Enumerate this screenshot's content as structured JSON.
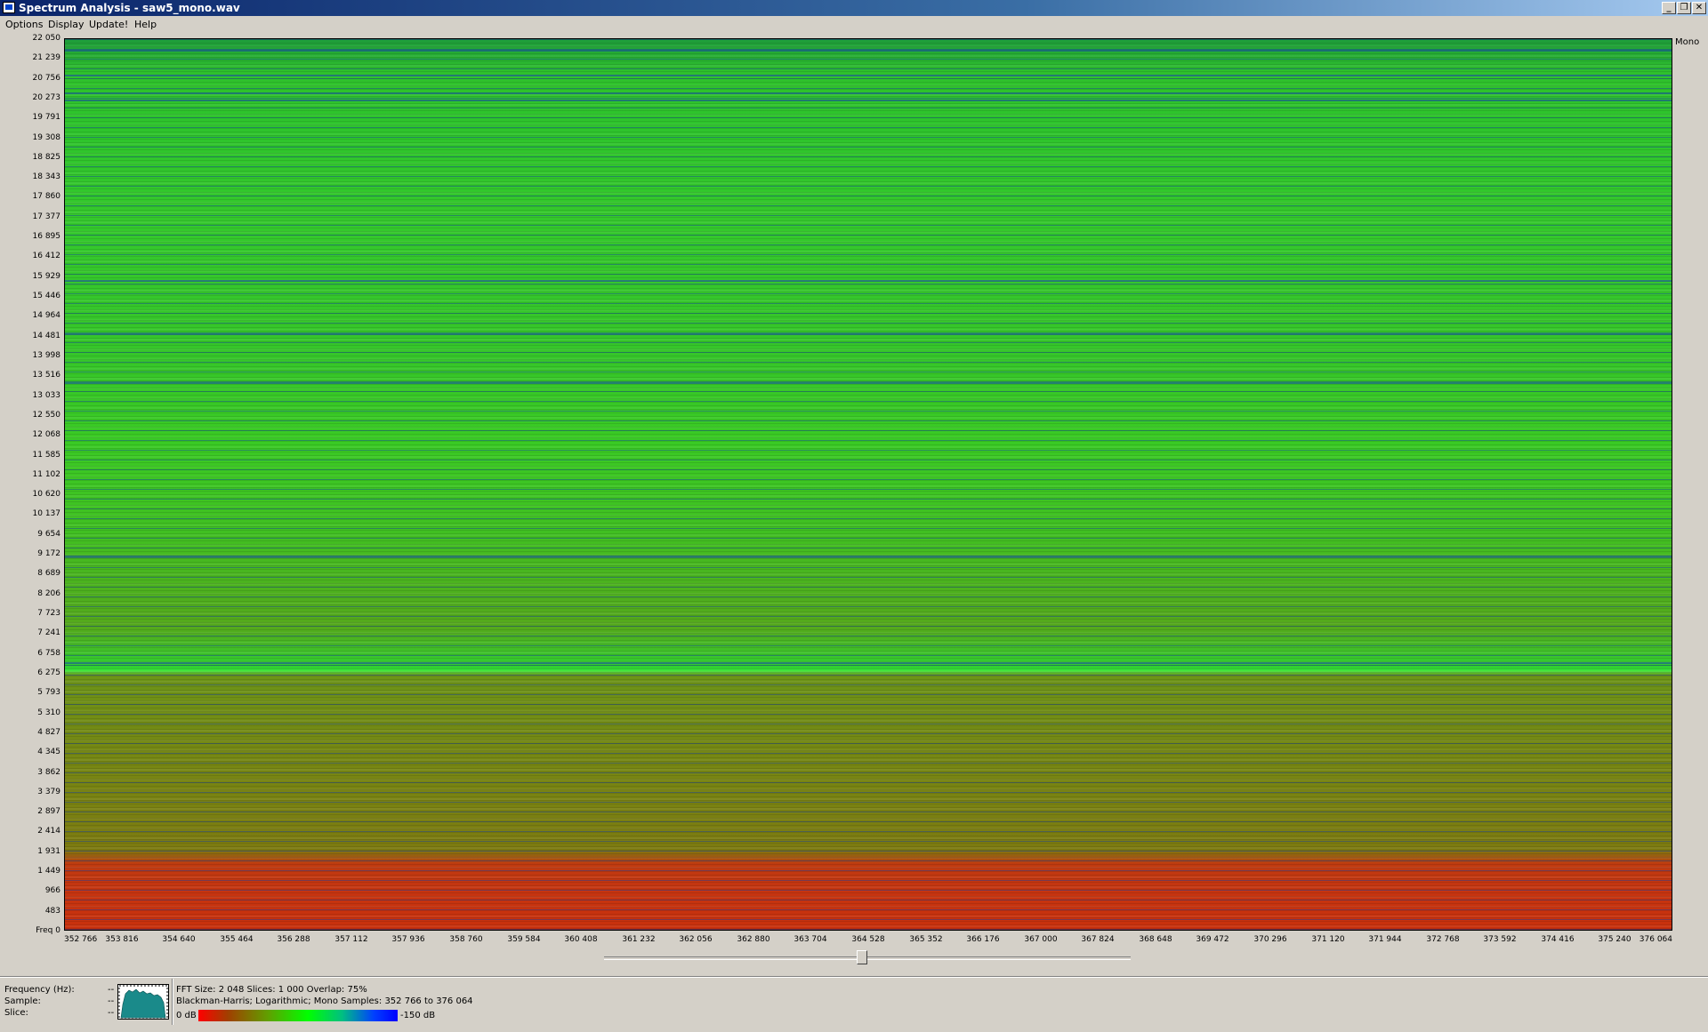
{
  "window": {
    "title": "Spectrum Analysis - saw5_mono.wav",
    "minimize_glyph": "_",
    "restore_glyph": "❐",
    "close_glyph": "✕"
  },
  "menu": {
    "items": [
      "Options",
      "Display",
      "Update!",
      "Help"
    ]
  },
  "plot": {
    "channel_label": "Mono",
    "y_ticks": [
      "22 050",
      "21 239",
      "20 756",
      "20 273",
      "19 791",
      "19 308",
      "18 825",
      "18 343",
      "17 860",
      "17 377",
      "16 895",
      "16 412",
      "15 929",
      "15 446",
      "14 964",
      "14 481",
      "13 998",
      "13 516",
      "13 033",
      "12 550",
      "12 068",
      "11 585",
      "11 102",
      "10 620",
      "10 137",
      "9 654",
      "9 172",
      "8 689",
      "8 206",
      "7 723",
      "7 241",
      "6 758",
      "6 275",
      "5 793",
      "5 310",
      "4 827",
      "4 345",
      "3 862",
      "3 379",
      "2 897",
      "2 414",
      "1 931",
      "1 449",
      "966",
      "483",
      "Freq 0"
    ],
    "x_ticks": [
      "352 766",
      "353 816",
      "354 640",
      "355 464",
      "356 288",
      "357 112",
      "357 936",
      "358 760",
      "359 584",
      "360 408",
      "361 232",
      "362 056",
      "362 880",
      "363 704",
      "364 528",
      "365 352",
      "366 176",
      "367 000",
      "367 824",
      "368 648",
      "369 472",
      "370 296",
      "371 120",
      "371 944",
      "372 768",
      "373 592",
      "374 416",
      "375 240",
      "376 064"
    ],
    "colors": {
      "high": "#c8300c",
      "mid": "#36c62a",
      "low_level": "#1e5ab4"
    }
  },
  "status": {
    "labels": {
      "frequency": "Frequency (Hz):",
      "sample": "Sample:",
      "slice": "Slice:"
    },
    "values": {
      "frequency": "--",
      "sample": "--",
      "slice": "--"
    },
    "info_line1": "FFT Size: 2 048  Slices: 1 000  Overlap: 75%",
    "info_line2": "Blackman-Harris; Logarithmic; Mono  Samples: 352 766 to 376 064",
    "scale_min": "0 dB",
    "scale_max": "-150 dB",
    "scrollbar_position": 0.49
  }
}
